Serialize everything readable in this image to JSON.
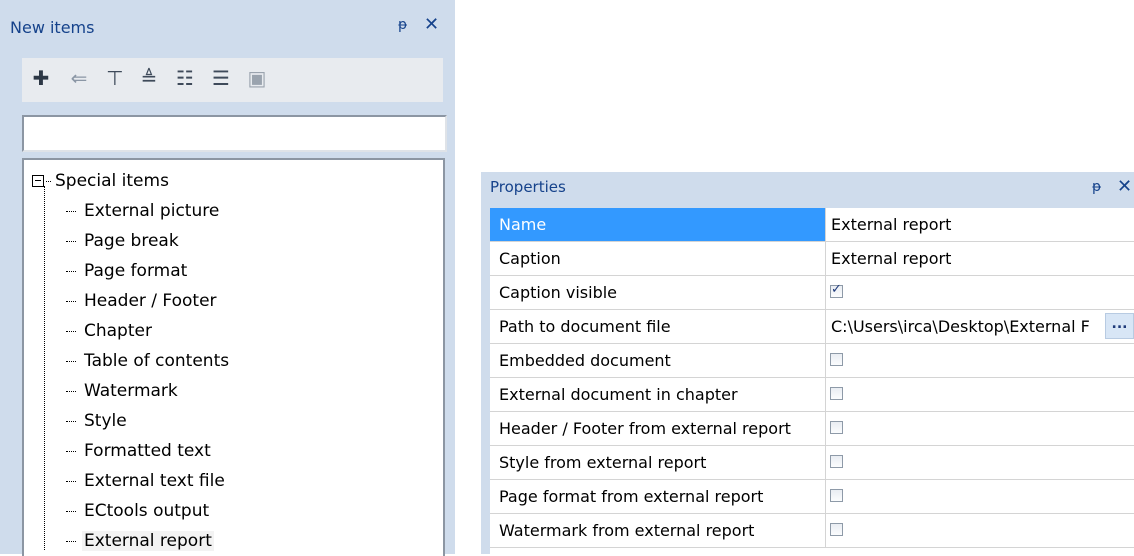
{
  "new_items": {
    "title": "New items",
    "pin": "ᵽ",
    "close": "✕",
    "toolbar": [
      {
        "icon": "add-item-icon",
        "glyph": "✚"
      },
      {
        "icon": "back-arrow-icon",
        "glyph": "⇐"
      },
      {
        "icon": "filter-icon",
        "glyph": "⊤"
      },
      {
        "icon": "sort-alpha-icon",
        "glyph": "≜"
      },
      {
        "icon": "tree-view-icon",
        "glyph": "☷"
      },
      {
        "icon": "list-view-icon",
        "glyph": "☰"
      },
      {
        "icon": "delete-icon",
        "glyph": "▣"
      }
    ],
    "search_value": "",
    "tree": {
      "root": "Special items",
      "items": [
        "External picture",
        "Page break",
        "Page format",
        "Header / Footer",
        "Chapter",
        "Table of contents",
        "Watermark",
        "Style",
        "Formatted text",
        "External text file",
        "ECtools output",
        "External report"
      ],
      "selected": "External report"
    }
  },
  "properties": {
    "title": "Properties",
    "pin": "ᵽ",
    "close": "✕",
    "rows": [
      {
        "name": "Name",
        "value": "External report",
        "type": "text",
        "selected": true
      },
      {
        "name": "Caption",
        "value": "External report",
        "type": "text"
      },
      {
        "name": "Caption visible",
        "checked": true,
        "type": "checkbox"
      },
      {
        "name": "Path to document file",
        "value": "C:\\Users\\irca\\Desktop\\External F",
        "type": "path",
        "button": "..."
      },
      {
        "name": "Embedded document",
        "checked": false,
        "type": "checkbox"
      },
      {
        "name": "External document in chapter",
        "checked": false,
        "type": "checkbox"
      },
      {
        "name": "Header / Footer from external report",
        "checked": false,
        "type": "checkbox"
      },
      {
        "name": "Style from external report",
        "checked": false,
        "type": "checkbox"
      },
      {
        "name": "Page format from external report",
        "checked": false,
        "type": "checkbox"
      },
      {
        "name": "Watermark from external report",
        "checked": false,
        "type": "checkbox"
      }
    ]
  },
  "colors": {
    "panel_bg": "#cfdcec",
    "title_text": "#15428b",
    "selection": "#3399ff"
  }
}
